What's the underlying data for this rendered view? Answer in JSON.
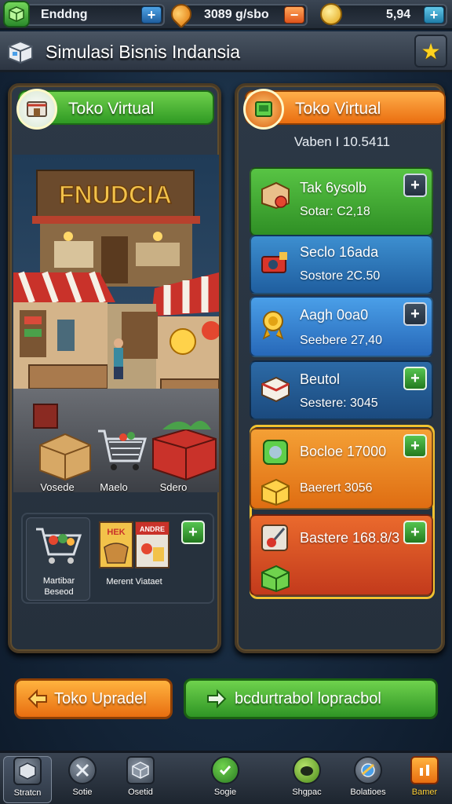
{
  "topbar": {
    "resource1": "Enddng",
    "resource2": "3089 g/sbo",
    "resource3": "5,94",
    "add_glyph": "+",
    "minus_glyph": "−"
  },
  "header": {
    "title": "Simulasi Bisnis Indansia",
    "star_glyph": "★"
  },
  "left_panel": {
    "header": "Toko Virtual",
    "store_sign": "FNUDCIA",
    "categories": [
      "Vosede",
      "Maelo",
      "Sdero"
    ],
    "sub_items": [
      {
        "label_line1": "Martibar",
        "label_line2": "Beseod"
      },
      {
        "label_line1": "Merent Viataet",
        "label_line2": ""
      }
    ],
    "stall_sign_1": "HEK",
    "stall_sign_2": "ANDRE"
  },
  "right_panel": {
    "header": "Toko Virtual",
    "version": "Vaben I 10.5411",
    "items": [
      {
        "title": "Tak 6ysolb",
        "sub": "Sotar: C2,18",
        "icon": "grocery-box-icon"
      },
      {
        "title": "Seclo 16ada",
        "sub": "Sostore 2C.50",
        "icon": "cash-register-icon"
      },
      {
        "title": "Aagh 0oa0",
        "sub": "Seebere 27,40",
        "icon": "gold-medal-icon"
      },
      {
        "title": "Beutol",
        "sub": "Sestere: 3045",
        "icon": "product-box-icon"
      },
      {
        "title": "Bocloe 17000",
        "sub": "",
        "icon": "green-token-icon"
      },
      {
        "title": "",
        "sub": "Baerert 3056",
        "icon": "yellow-crate-icon"
      },
      {
        "title": "Bastere 168.8/3",
        "sub": "",
        "icon": "tool-icon"
      },
      {
        "title": "",
        "sub": "",
        "icon": "green-crate-icon"
      }
    ],
    "add_glyph": "+"
  },
  "actions": {
    "upgrade": "Toko Upradel",
    "primary": "bcdurtrabol lopracbol"
  },
  "nav": [
    {
      "label": "Stratcn",
      "icon": "box-icon"
    },
    {
      "label": "Sotie",
      "icon": "tools-icon"
    },
    {
      "label": "Osetid",
      "icon": "crate-icon"
    },
    {
      "label": "Sogie",
      "icon": "check-icon"
    },
    {
      "label": "Shgpac",
      "icon": "gamepad-icon"
    },
    {
      "label": "Bolatioes",
      "icon": "globe-icon"
    },
    {
      "label": "Bamer",
      "icon": "chart-icon"
    }
  ],
  "colors": {
    "accent_green": "#2f9a24",
    "accent_orange": "#ea6e10",
    "accent_blue": "#1f5e9f",
    "gold_frame": "#f2c230"
  }
}
